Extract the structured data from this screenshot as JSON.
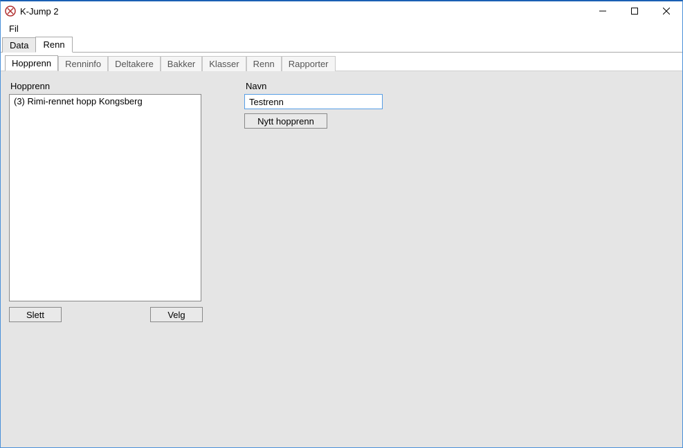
{
  "window": {
    "title": "K-Jump 2"
  },
  "menu": {
    "file": "Fil"
  },
  "main_tabs": [
    {
      "label": "Data",
      "active": false
    },
    {
      "label": "Renn",
      "active": true
    }
  ],
  "sub_tabs": [
    {
      "label": "Hopprenn",
      "active": true
    },
    {
      "label": "Renninfo",
      "active": false
    },
    {
      "label": "Deltakere",
      "active": false
    },
    {
      "label": "Bakker",
      "active": false
    },
    {
      "label": "Klasser",
      "active": false
    },
    {
      "label": "Renn",
      "active": false
    },
    {
      "label": "Rapporter",
      "active": false
    }
  ],
  "left_panel": {
    "heading": "Hopprenn",
    "items": [
      "(3) Rimi-rennet hopp Kongsberg"
    ],
    "delete_label": "Slett",
    "select_label": "Velg"
  },
  "right_panel": {
    "heading": "Navn",
    "name_value": "Testrenn",
    "new_button_label": "Nytt hopprenn"
  }
}
